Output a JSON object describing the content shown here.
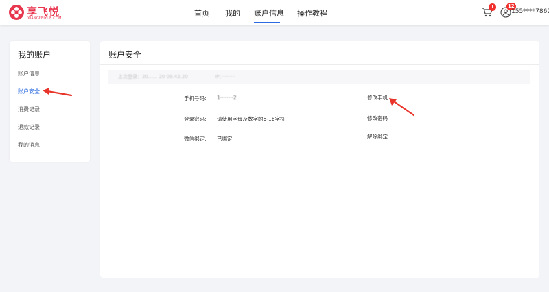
{
  "header": {
    "logo_text": "享飞悦",
    "logo_sub": "XIANGFEIYUE.COM",
    "nav": [
      {
        "label": "首页"
      },
      {
        "label": "我的"
      },
      {
        "label": "账户信息",
        "active": true
      },
      {
        "label": "操作教程"
      }
    ],
    "cart_badge": "1",
    "user_badge": "12",
    "user_phone": "155****7862"
  },
  "sidebar": {
    "title": "我的账户",
    "items": [
      {
        "label": "账户信息"
      },
      {
        "label": "账户安全",
        "active": true
      },
      {
        "label": "消费记录"
      },
      {
        "label": "退款记录"
      },
      {
        "label": "我的消息"
      }
    ]
  },
  "main": {
    "title": "账户安全",
    "last_login_label": "上次登录：20...... 20 09.42.20",
    "ip_label": "IP：·········",
    "rows": [
      {
        "label": "手机号码:",
        "value": "1········2",
        "action": "修改手机"
      },
      {
        "label": "登录密码:",
        "value": "请使用字母及数字的6-16字符",
        "action": "修改密码"
      },
      {
        "label": "微信绑定:",
        "value": "已绑定",
        "action": "解除绑定"
      }
    ]
  },
  "colors": {
    "accent": "#2b6ae0",
    "brand": "#e8364f",
    "annotation_arrow": "#e8342a",
    "badge": "#f0312d"
  }
}
